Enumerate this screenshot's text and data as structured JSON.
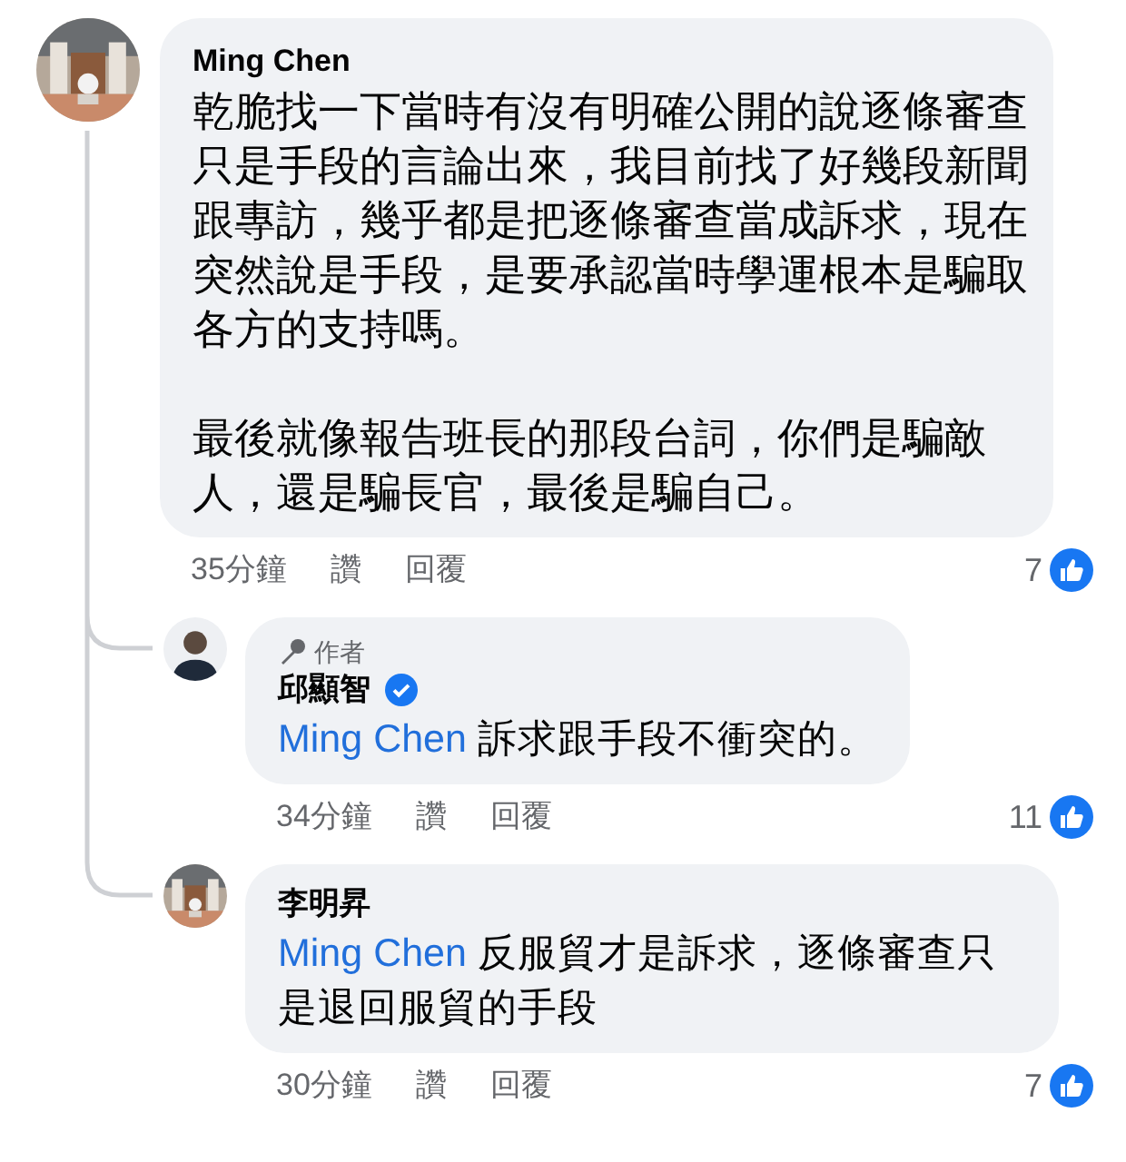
{
  "comment": {
    "author": "Ming Chen",
    "paragraphs": [
      "乾脆找一下當時有沒有明確公開的說逐條審查只是手段的言論出來，我目前找了好幾段新聞跟專訪，幾乎都是把逐條審查當成訴求，現在突然說是手段，是要承認當時學運根本是騙取各方的支持嗎。",
      "最後就像報告班長的那段台詞，你們是騙敵人，還是騙長官，最後是騙自己。"
    ],
    "time": "35分鐘",
    "actions": [
      "讚",
      "回覆"
    ],
    "likes": "7",
    "replies": [
      {
        "avatar": {
          "kind": "silhouette"
        },
        "badge": "作者",
        "author": "邱顯智",
        "verified": true,
        "mention": "Ming Chen",
        "text": "訴求跟手段不衝突的。",
        "time": "34分鐘",
        "actions": [
          "讚",
          "回覆"
        ],
        "likes": "11"
      },
      {
        "author": "李明昇",
        "verified": false,
        "mention": "Ming Chen",
        "text": "反服貿才是訴求，逐條審查只是退回服貿的手段",
        "time": "30分鐘",
        "actions": [
          "讚",
          "回覆"
        ],
        "likes": "7"
      }
    ]
  }
}
